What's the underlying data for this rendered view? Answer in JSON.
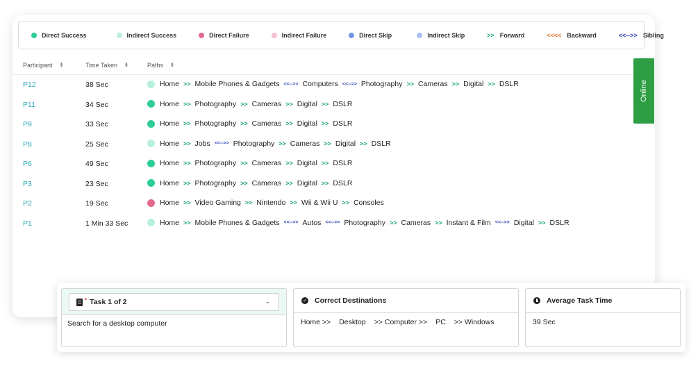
{
  "legend": [
    {
      "label": "Direct Success",
      "marker": "dot",
      "color": "#2ecc9a"
    },
    {
      "label": "Indirect Success",
      "marker": "dot",
      "color": "#b7f0dc"
    },
    {
      "label": "Direct Failure",
      "marker": "dot",
      "color": "#e46a8d"
    },
    {
      "label": "Indirect Failure",
      "marker": "dot",
      "color": "#f6bfd0"
    },
    {
      "label": "Direct Skip",
      "marker": "dot",
      "color": "#6f97e3"
    },
    {
      "label": "Indirect Skip",
      "marker": "dot",
      "color": "#a9c2f2"
    },
    {
      "label": "Forward",
      "marker": "arrow",
      "symbol": ">>",
      "color": "#1aa56a"
    },
    {
      "label": "Backward",
      "marker": "arrow",
      "symbol": "<<<<",
      "color": "#e57a37"
    },
    {
      "label": "Sibling",
      "marker": "arrow",
      "symbol": "<<-->>",
      "color": "#2a3fb0"
    }
  ],
  "table": {
    "headers": {
      "participant": "Participant",
      "time": "Time Taken",
      "paths": "Paths"
    },
    "rows": [
      {
        "participant": "P12",
        "time": "38 Sec",
        "status_color": "#b7f0dc",
        "path": [
          {
            "t": "Home"
          },
          {
            "s": "fwd"
          },
          {
            "t": "Mobile Phones & Gadgets"
          },
          {
            "s": "sib"
          },
          {
            "t": "Computers"
          },
          {
            "s": "sib"
          },
          {
            "t": "Photography"
          },
          {
            "s": "fwd"
          },
          {
            "t": "Cameras"
          },
          {
            "s": "fwd"
          },
          {
            "t": "Digital"
          },
          {
            "s": "fwd"
          },
          {
            "t": "DSLR"
          }
        ]
      },
      {
        "participant": "P11",
        "time": "34 Sec",
        "status_color": "#2ecc9a",
        "path": [
          {
            "t": "Home"
          },
          {
            "s": "fwd"
          },
          {
            "t": "Photography"
          },
          {
            "s": "fwd"
          },
          {
            "t": "Cameras"
          },
          {
            "s": "fwd"
          },
          {
            "t": "Digital"
          },
          {
            "s": "fwd"
          },
          {
            "t": "DSLR"
          }
        ]
      },
      {
        "participant": "P9",
        "time": "33 Sec",
        "status_color": "#2ecc9a",
        "path": [
          {
            "t": "Home"
          },
          {
            "s": "fwd"
          },
          {
            "t": "Photography"
          },
          {
            "s": "fwd"
          },
          {
            "t": "Cameras"
          },
          {
            "s": "fwd"
          },
          {
            "t": "Digital"
          },
          {
            "s": "fwd"
          },
          {
            "t": "DSLR"
          }
        ]
      },
      {
        "participant": "P8",
        "time": "25 Sec",
        "status_color": "#b7f0dc",
        "path": [
          {
            "t": "Home"
          },
          {
            "s": "fwd"
          },
          {
            "t": "Jobs"
          },
          {
            "s": "sib"
          },
          {
            "t": "Photography"
          },
          {
            "s": "fwd"
          },
          {
            "t": "Cameras"
          },
          {
            "s": "fwd"
          },
          {
            "t": "Digital"
          },
          {
            "s": "fwd"
          },
          {
            "t": "DSLR"
          }
        ]
      },
      {
        "participant": "P6",
        "time": "49 Sec",
        "status_color": "#2ecc9a",
        "path": [
          {
            "t": "Home"
          },
          {
            "s": "fwd"
          },
          {
            "t": "Photography"
          },
          {
            "s": "fwd"
          },
          {
            "t": "Cameras"
          },
          {
            "s": "fwd"
          },
          {
            "t": "Digital"
          },
          {
            "s": "fwd"
          },
          {
            "t": "DSLR"
          }
        ]
      },
      {
        "participant": "P3",
        "time": "23 Sec",
        "status_color": "#2ecc9a",
        "path": [
          {
            "t": "Home"
          },
          {
            "s": "fwd"
          },
          {
            "t": "Photography"
          },
          {
            "s": "fwd"
          },
          {
            "t": "Cameras"
          },
          {
            "s": "fwd"
          },
          {
            "t": "Digital"
          },
          {
            "s": "fwd"
          },
          {
            "t": "DSLR"
          }
        ]
      },
      {
        "participant": "P2",
        "time": "19 Sec",
        "status_color": "#e46a8d",
        "path": [
          {
            "t": "Home"
          },
          {
            "s": "fwd"
          },
          {
            "t": "Video Gaming"
          },
          {
            "s": "fwd"
          },
          {
            "t": "Nintendo"
          },
          {
            "s": "fwd"
          },
          {
            "t": "Wii & Wii U"
          },
          {
            "s": "fwd"
          },
          {
            "t": "Consoles"
          }
        ]
      },
      {
        "participant": "P1",
        "time": "1 Min 33 Sec",
        "status_color": "#b7f0dc",
        "path": [
          {
            "t": "Home"
          },
          {
            "s": "fwd"
          },
          {
            "t": "Mobile Phones & Gadgets"
          },
          {
            "s": "sib"
          },
          {
            "t": "Autos"
          },
          {
            "s": "sib"
          },
          {
            "t": "Photography"
          },
          {
            "s": "fwd"
          },
          {
            "t": "Cameras"
          },
          {
            "s": "fwd"
          },
          {
            "t": "Instant & Film"
          },
          {
            "s": "sib"
          },
          {
            "t": "Digital"
          },
          {
            "s": "fwd"
          },
          {
            "t": "DSLR"
          }
        ]
      }
    ]
  },
  "separators": {
    "fwd": ">>",
    "sib": "<<-->>"
  },
  "online_tab": "Online",
  "task": {
    "selector_label": "Task 1 of 2",
    "description": "Search for a desktop computer"
  },
  "correct_destinations": {
    "title": "Correct Destinations",
    "parts": [
      "Home >>",
      "Desktop",
      ">> Computer >>",
      "PC",
      ">> Windows"
    ]
  },
  "average_task_time": {
    "title": "Average Task Time",
    "value": "39 Sec"
  },
  "icons": {
    "task": "clipboard-icon",
    "dest": "check-circle-icon",
    "time": "clock-icon",
    "dropdown": "chevron-down-icon",
    "sort": "sort-icon"
  }
}
